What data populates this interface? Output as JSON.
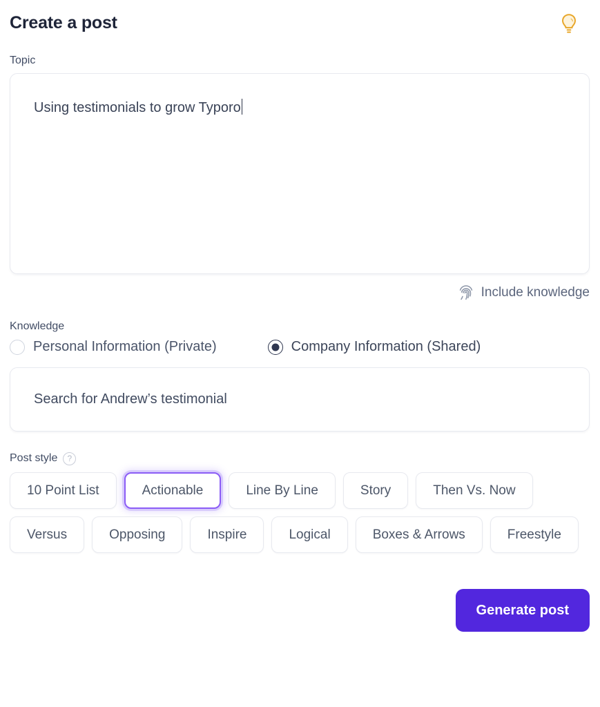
{
  "header": {
    "title": "Create a post",
    "bulb_icon": "lightbulb-icon",
    "bulb_color": "#e8a72b"
  },
  "topic": {
    "label": "Topic",
    "value": "Using testimonials to grow Typoro",
    "placeholder": "",
    "has_caret": true
  },
  "include_knowledge": {
    "label": "Include knowledge",
    "icon": "fingerprint-icon"
  },
  "knowledge": {
    "label": "Knowledge",
    "options": [
      {
        "label": "Personal Information (Private)",
        "selected": false
      },
      {
        "label": "Company Information (Shared)",
        "selected": true
      }
    ]
  },
  "search": {
    "value": "Search for Andrew’s testimonial",
    "placeholder": "Search for Andrew’s testimonial"
  },
  "post_style": {
    "label": "Post style",
    "help_icon": "help-circle-icon",
    "help_glyph": "?",
    "selected": "Actionable",
    "accent_color": "#8b5cf6",
    "options": [
      {
        "label": "10 Point List",
        "selected": false
      },
      {
        "label": "Actionable",
        "selected": true
      },
      {
        "label": "Line By Line",
        "selected": false
      },
      {
        "label": "Story",
        "selected": false
      },
      {
        "label": "Then Vs. Now",
        "selected": false
      },
      {
        "label": "Versus",
        "selected": false
      },
      {
        "label": "Opposing",
        "selected": false
      },
      {
        "label": "Inspire",
        "selected": false
      },
      {
        "label": "Logical",
        "selected": false
      },
      {
        "label": "Boxes & Arrows",
        "selected": false
      },
      {
        "label": "Freestyle",
        "selected": false
      }
    ]
  },
  "footer": {
    "generate_label": "Generate post",
    "generate_color": "#5227de"
  }
}
